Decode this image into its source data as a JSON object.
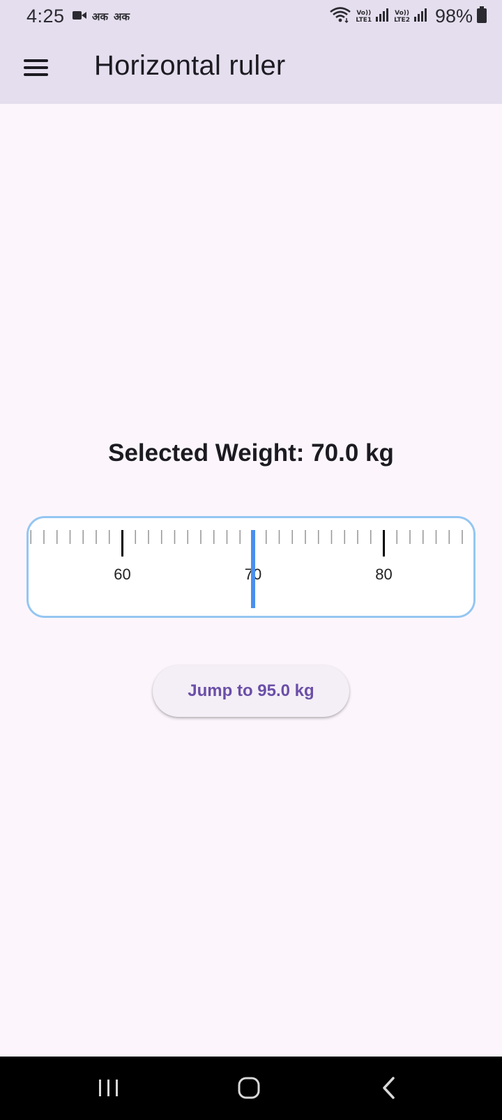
{
  "status_bar": {
    "time": "4:25",
    "hindi_icon_1": "अक",
    "hindi_icon_2": "अक",
    "lte1_top": "Vo))",
    "lte1_bottom": "LTE1",
    "lte2_top": "Vo))",
    "lte2_bottom": "LTE2",
    "battery": "98%"
  },
  "app_bar": {
    "title": "Horizontal ruler"
  },
  "main": {
    "selected_weight_label": "Selected Weight: 70.0 kg",
    "jump_button_label": "Jump to 95.0 kg"
  },
  "ruler": {
    "selected_value": 70.0,
    "unit": "kg",
    "major_labels": [
      "60",
      "70",
      "80"
    ],
    "indicator_color": "#4a8fee",
    "border_color": "#94c6f2"
  },
  "icons": {
    "menu": "menu-icon",
    "video": "video-camera-icon",
    "wifi": "wifi-icon",
    "signal": "signal-icon",
    "battery": "battery-icon",
    "nav_recents": "recents-icon",
    "nav_home": "home-icon",
    "nav_back": "back-icon"
  }
}
